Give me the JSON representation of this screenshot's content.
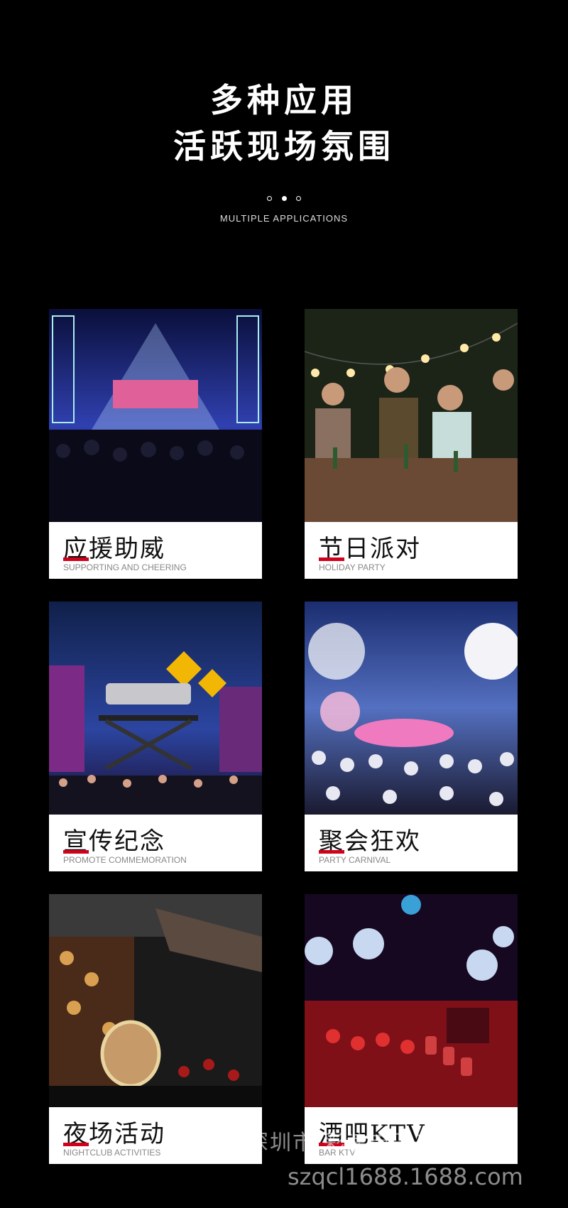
{
  "header": {
    "title_line1": "多种应用",
    "title_line2": "活跃现场氛围",
    "subtitle": "MULTIPLE APPLICATIONS"
  },
  "cards": [
    {
      "zh": "应援助威",
      "en": "SUPPORTING AND CHEERING",
      "image": "concert-stage-image"
    },
    {
      "zh": "节日派对",
      "en": "HOLIDAY PARTY",
      "image": "outdoor-party-image"
    },
    {
      "zh": "宣传纪念",
      "en": "PROMOTE COMMEMORATION",
      "image": "promo-stage-car-image"
    },
    {
      "zh": "聚会狂欢",
      "en": "PARTY CARNIVAL",
      "image": "crowd-carnival-image"
    },
    {
      "zh": "夜场活动",
      "en": "NIGHTCLUB ACTIVITIES",
      "image": "parade-float-image"
    },
    {
      "zh": "酒吧KTV",
      "en": "BAR KTV",
      "image": "bar-ktv-image"
    }
  ],
  "watermark": {
    "line1": "深圳市 彩浪电子有限公司",
    "line2": "szqcl1688.1688.com"
  },
  "colors": {
    "background": "#000000",
    "accent": "#d0021b",
    "card": "#ffffff"
  }
}
